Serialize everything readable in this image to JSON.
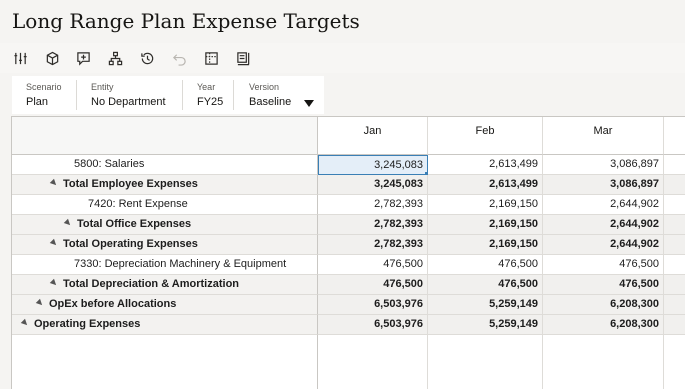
{
  "page": {
    "title": "Long Range Plan Expense Targets"
  },
  "toolbar": {
    "icons": [
      "filter-sliders-icon",
      "cube-icon",
      "add-note-icon",
      "hierarchy-icon",
      "history-icon",
      "undo-icon",
      "grid-options-icon",
      "form-layout-icon"
    ]
  },
  "pov": {
    "scenario": {
      "label": "Scenario",
      "value": "Plan"
    },
    "entity": {
      "label": "Entity",
      "value": "No Department"
    },
    "year": {
      "label": "Year",
      "value": "FY25"
    },
    "version": {
      "label": "Version",
      "value": "Baseline"
    }
  },
  "grid": {
    "columns": [
      "Jan",
      "Feb",
      "Mar"
    ],
    "rows": [
      {
        "label": "5800: Salaries",
        "values": [
          "3,245,083",
          "2,613,499",
          "3,086,897"
        ]
      },
      {
        "label": "Total Employee Expenses",
        "values": [
          "3,245,083",
          "2,613,499",
          "3,086,897"
        ]
      },
      {
        "label": "7420: Rent Expense",
        "values": [
          "2,782,393",
          "2,169,150",
          "2,644,902"
        ]
      },
      {
        "label": "Total Office Expenses",
        "values": [
          "2,782,393",
          "2,169,150",
          "2,644,902"
        ]
      },
      {
        "label": "Total Operating Expenses",
        "values": [
          "2,782,393",
          "2,169,150",
          "2,644,902"
        ]
      },
      {
        "label": "7330: Depreciation Machinery & Equipment",
        "values": [
          "476,500",
          "476,500",
          "476,500"
        ]
      },
      {
        "label": "Total Depreciation & Amortization",
        "values": [
          "476,500",
          "476,500",
          "476,500"
        ]
      },
      {
        "label": "OpEx before Allocations",
        "values": [
          "6,503,976",
          "5,259,149",
          "6,208,300"
        ]
      },
      {
        "label": "Operating Expenses",
        "values": [
          "6,503,976",
          "5,259,149",
          "6,208,300"
        ]
      }
    ]
  }
}
